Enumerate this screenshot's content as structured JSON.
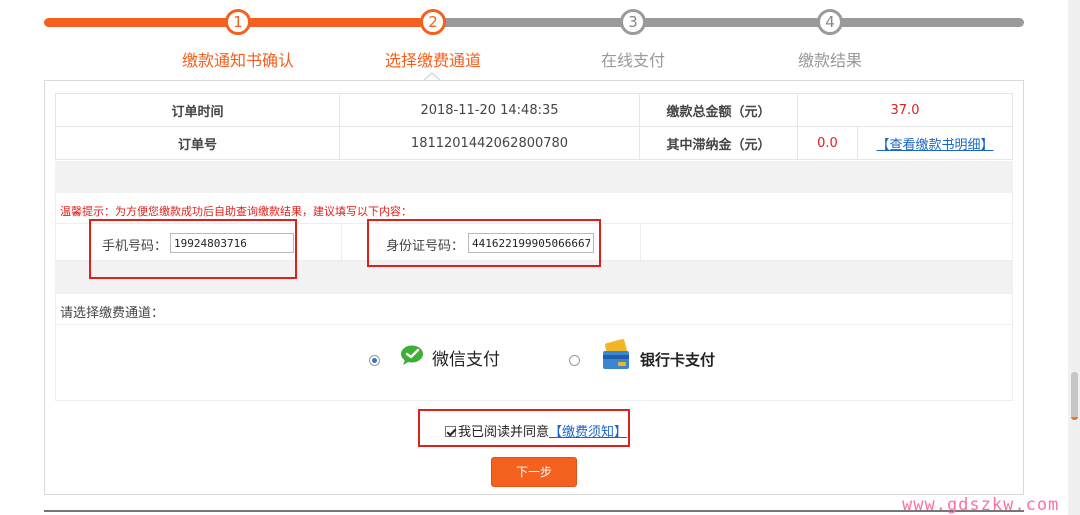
{
  "steps": [
    {
      "num": "1",
      "label": "缴款通知书确认"
    },
    {
      "num": "2",
      "label": "选择缴费通道"
    },
    {
      "num": "3",
      "label": "在线支付"
    },
    {
      "num": "4",
      "label": "缴款结果"
    }
  ],
  "order": {
    "time_label": "订单时间",
    "time_value": "2018-11-20 14:48:35",
    "total_label": "缴款总金额（元）",
    "total_value": "37.0",
    "number_label": "订单号",
    "number_value": "1811201442062800780",
    "late_fee_label": "其中滞纳金（元）",
    "late_fee_value": "0.0",
    "detail_link": "【查看缴款书明细】"
  },
  "tip": "温馨提示：为方便您缴款成功后自助查询缴款结果，建议填写以下内容：",
  "contact": {
    "phone_label": "手机号码：",
    "phone_value": "19924803716",
    "id_label": "身份证号码：",
    "id_value": "441622199905066667"
  },
  "channel": {
    "title": "请选择缴费通道：",
    "wechat_label": "微信支付",
    "bank_label": "银行卡支付",
    "selected": "wechat"
  },
  "agree": {
    "text": "我已阅读并同意",
    "link": "【缴费须知】",
    "checked": true
  },
  "next_button": "下一步",
  "watermark": "www.gdszkw.com",
  "colors": {
    "accent": "#f4601e",
    "inactive": "#9a9a9a",
    "red": "#e0201b",
    "link": "#1a66c7",
    "wechat_green": "#3cb034"
  }
}
